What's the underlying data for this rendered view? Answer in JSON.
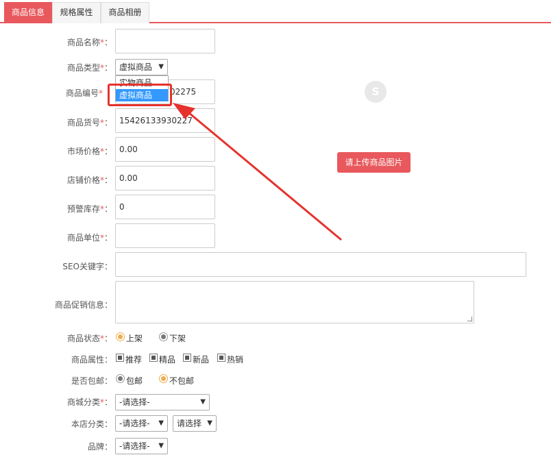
{
  "tabs": [
    {
      "label": "商品信息",
      "active": true
    },
    {
      "label": "规格属性",
      "active": false
    },
    {
      "label": "商品相册",
      "active": false
    }
  ],
  "form": {
    "name": {
      "label": "商品名称",
      "required": true,
      "value": ""
    },
    "type": {
      "label": "商品类型",
      "required": true,
      "value": "虚拟商品",
      "options": [
        "实物商品",
        "虚拟商品"
      ],
      "highlighted_option": "虚拟商品"
    },
    "code": {
      "label": "商品编号",
      "required": true,
      "value_visible_suffix": "02275"
    },
    "sku": {
      "label": "商品货号",
      "required": true,
      "value": "15426133930227"
    },
    "market_price": {
      "label": "市场价格",
      "required": true,
      "value": "0.00"
    },
    "shop_price": {
      "label": "店铺价格",
      "required": true,
      "value": "0.00"
    },
    "stock_alert": {
      "label": "预警库存",
      "required": true,
      "value": "0"
    },
    "unit": {
      "label": "商品单位",
      "required": true,
      "value": ""
    },
    "seo": {
      "label": "SEO关键字",
      "required": false,
      "value": ""
    },
    "promo": {
      "label": "商品促销信息",
      "required": false,
      "value": ""
    },
    "status": {
      "label": "商品状态",
      "required": true,
      "options": [
        "上架",
        "下架"
      ],
      "selected": "上架"
    },
    "attrs": {
      "label": "商品属性",
      "options": [
        "推荐",
        "精品",
        "新品",
        "热销"
      ]
    },
    "shipping": {
      "label": "是否包邮",
      "options": [
        "包邮",
        "不包邮"
      ],
      "selected": "不包邮"
    },
    "mall_cat": {
      "label": "商城分类",
      "value": "-请选择-"
    },
    "shop_cat": {
      "label": "本店分类",
      "value1": "-请选择-",
      "value2": "请选择"
    },
    "brand": {
      "label": "品牌",
      "value": "-请选择-"
    }
  },
  "label_suffix": "：",
  "required_mark": "*",
  "upload_button": "请上传商品图片",
  "colors": {
    "accent": "#e8585c",
    "annotation_red": "#e5322d",
    "selection_blue": "#3399ff",
    "radio_on": "#f0ad4e"
  },
  "annotation": {
    "type": "red arrow pointing to highlighted 虚拟商品 option"
  }
}
